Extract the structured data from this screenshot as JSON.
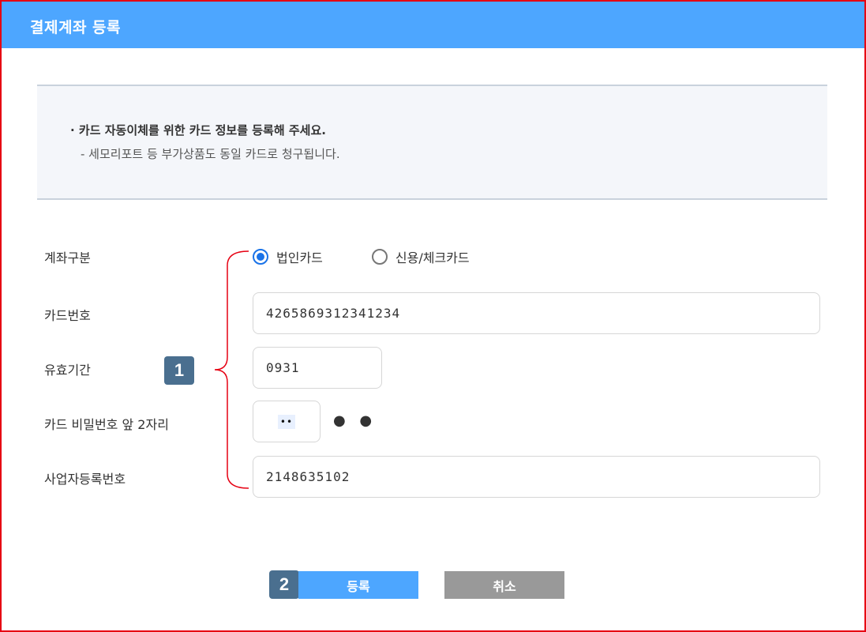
{
  "header": {
    "title": "결제계좌 등록"
  },
  "notice": {
    "line1": "· 카드 자동이체를 위한 카드 정보를 등록해 주세요.",
    "line2": "- 세모리포트 등 부가상품도 동일 카드로 청구됩니다."
  },
  "form": {
    "account_type_label": "계좌구분",
    "options": [
      {
        "label": "법인카드",
        "checked": true
      },
      {
        "label": "신용/체크카드",
        "checked": false
      }
    ],
    "card_number_label": "카드번호",
    "card_number_value": "4265869312341234",
    "expiry_label": "유효기간",
    "expiry_value": "0931",
    "pin_label": "카드 비밀번호 앞 2자리",
    "pin_value": "••",
    "pin_masked_suffix": "● ●",
    "biz_number_label": "사업자등록번호",
    "biz_number_value": "2148635102"
  },
  "annotations": {
    "badge1": "1",
    "badge2": "2"
  },
  "buttons": {
    "submit": "등록",
    "cancel": "취소"
  },
  "colors": {
    "header": "#4da6ff",
    "submit": "#4da6ff",
    "cancel": "#999999",
    "badge": "#4a6f8f",
    "frame_border": "#e60012",
    "bracket": "#e60012"
  }
}
